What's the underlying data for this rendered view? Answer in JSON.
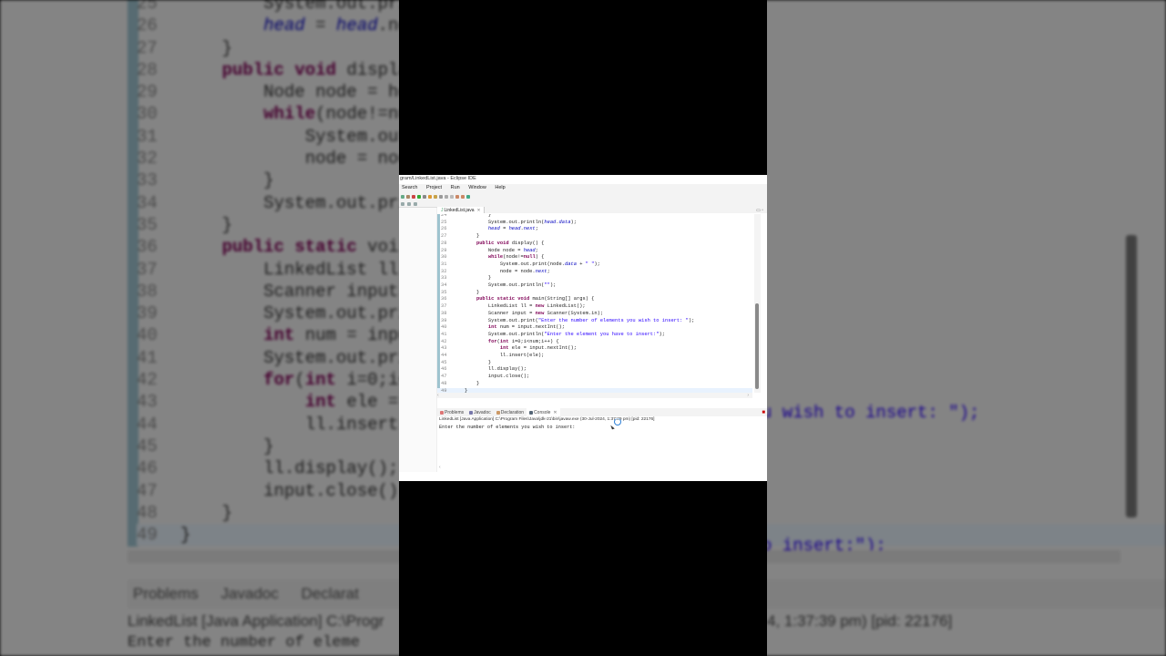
{
  "window": {
    "title": "gram/LinkedList.java - Eclipse IDE",
    "menu": [
      "Search",
      "Project",
      "Run",
      "Window",
      "Help"
    ]
  },
  "editor": {
    "tab_label": "LinkedList.java",
    "tab_close": "✕",
    "controls": "▭ ▫",
    "lines": [
      {
        "n": "24",
        "t": "        }"
      },
      {
        "n": "25",
        "t": "        System.out.println(head.data);"
      },
      {
        "n": "26",
        "t": "        head = head.next;"
      },
      {
        "n": "27",
        "t": "    }"
      },
      {
        "n": "28",
        "t": "    public void display() {"
      },
      {
        "n": "29",
        "t": "        Node node = head;"
      },
      {
        "n": "30",
        "t": "        while(node!=null) {"
      },
      {
        "n": "31",
        "t": "            System.out.print(node.data + \" \");"
      },
      {
        "n": "32",
        "t": "            node = node.next;"
      },
      {
        "n": "33",
        "t": "        }"
      },
      {
        "n": "34",
        "t": "        System.out.println(\"\");"
      },
      {
        "n": "35",
        "t": "    }"
      },
      {
        "n": "36",
        "t": "    public static void main(String[] args) {"
      },
      {
        "n": "37",
        "t": "        LinkedList ll = new LinkedList();"
      },
      {
        "n": "38",
        "t": "        Scanner input = new Scanner(System.in);"
      },
      {
        "n": "39",
        "t": "        System.out.print(\"Enter the number of elements you wish to insert: \");"
      },
      {
        "n": "40",
        "t": "        int num = input.nextInt();"
      },
      {
        "n": "41",
        "t": "        System.out.println(\"Enter the element you have to insert:\");"
      },
      {
        "n": "42",
        "t": "        for(int i=0;i<num;i++) {"
      },
      {
        "n": "43",
        "t": "            int ele = input.nextInt();"
      },
      {
        "n": "44",
        "t": "            ll.insert(ele);"
      },
      {
        "n": "45",
        "t": "        }"
      },
      {
        "n": "46",
        "t": "        ll.display();"
      },
      {
        "n": "47",
        "t": "        input.close();"
      },
      {
        "n": "48",
        "t": "    }"
      },
      {
        "n": "49",
        "t": "}"
      }
    ]
  },
  "bottom_panel": {
    "tabs": [
      "Problems",
      "Javadoc",
      "Declaration",
      "Console"
    ],
    "active_tab": "Console",
    "console_status": "LinkedList [Java Application] C:\\Program Files\\Java\\jdk-21\\bin\\javaw.exe  (30-Jul-2024, 1:37:39 pm) [pid: 22176]",
    "console_output": "Enter the number of elements you wish to insert:"
  },
  "background": {
    "lines": [
      {
        "n": "25",
        "t": "        System.out.pri"
      },
      {
        "n": "26",
        "t": "        head = head.ne"
      },
      {
        "n": "27",
        "t": "    }"
      },
      {
        "n": "28",
        "t": "    public void displa"
      },
      {
        "n": "29",
        "t": "        Node node = he"
      },
      {
        "n": "30",
        "t": "        while(node!=nu"
      },
      {
        "n": "31",
        "t": "            System.out"
      },
      {
        "n": "32",
        "t": "            node = noo"
      },
      {
        "n": "33",
        "t": "        }"
      },
      {
        "n": "34",
        "t": "        System.out.pri"
      },
      {
        "n": "35",
        "t": "    }"
      },
      {
        "n": "36",
        "t": "    public static voi"
      },
      {
        "n": "37",
        "t": "        LinkedList ll"
      },
      {
        "n": "38",
        "t": "        Scanner input"
      },
      {
        "n": "39",
        "t": "        System.out.pri"
      },
      {
        "n": "40",
        "t": "        int num = inpu"
      },
      {
        "n": "41",
        "t": "        System.out.pri"
      },
      {
        "n": "42",
        "t": "        for(int i=0;i<"
      },
      {
        "n": "43",
        "t": "            int ele ="
      },
      {
        "n": "44",
        "t": "            ll.insert("
      },
      {
        "n": "45",
        "t": "        }"
      },
      {
        "n": "46",
        "t": "        ll.display();"
      },
      {
        "n": "47",
        "t": "        input.close();"
      },
      {
        "n": "48",
        "t": "    }"
      },
      {
        "n": "49",
        "t": "}"
      }
    ],
    "right_out_1": "u wish to insert: \");",
    "right_out_2": "o insert:\");",
    "tabs": [
      "Problems",
      "Javadoc",
      "Declarat"
    ],
    "status_left": "LinkedList [Java Application] C:\\Progr",
    "status_right": "4, 1:37:39 pm) [pid: 22176]",
    "output": "Enter the number of eleme"
  },
  "colors": {
    "keyword": "#7f0055",
    "string": "#2a00ff",
    "field": "#0000c0",
    "gutter": "#9ec3cf"
  }
}
